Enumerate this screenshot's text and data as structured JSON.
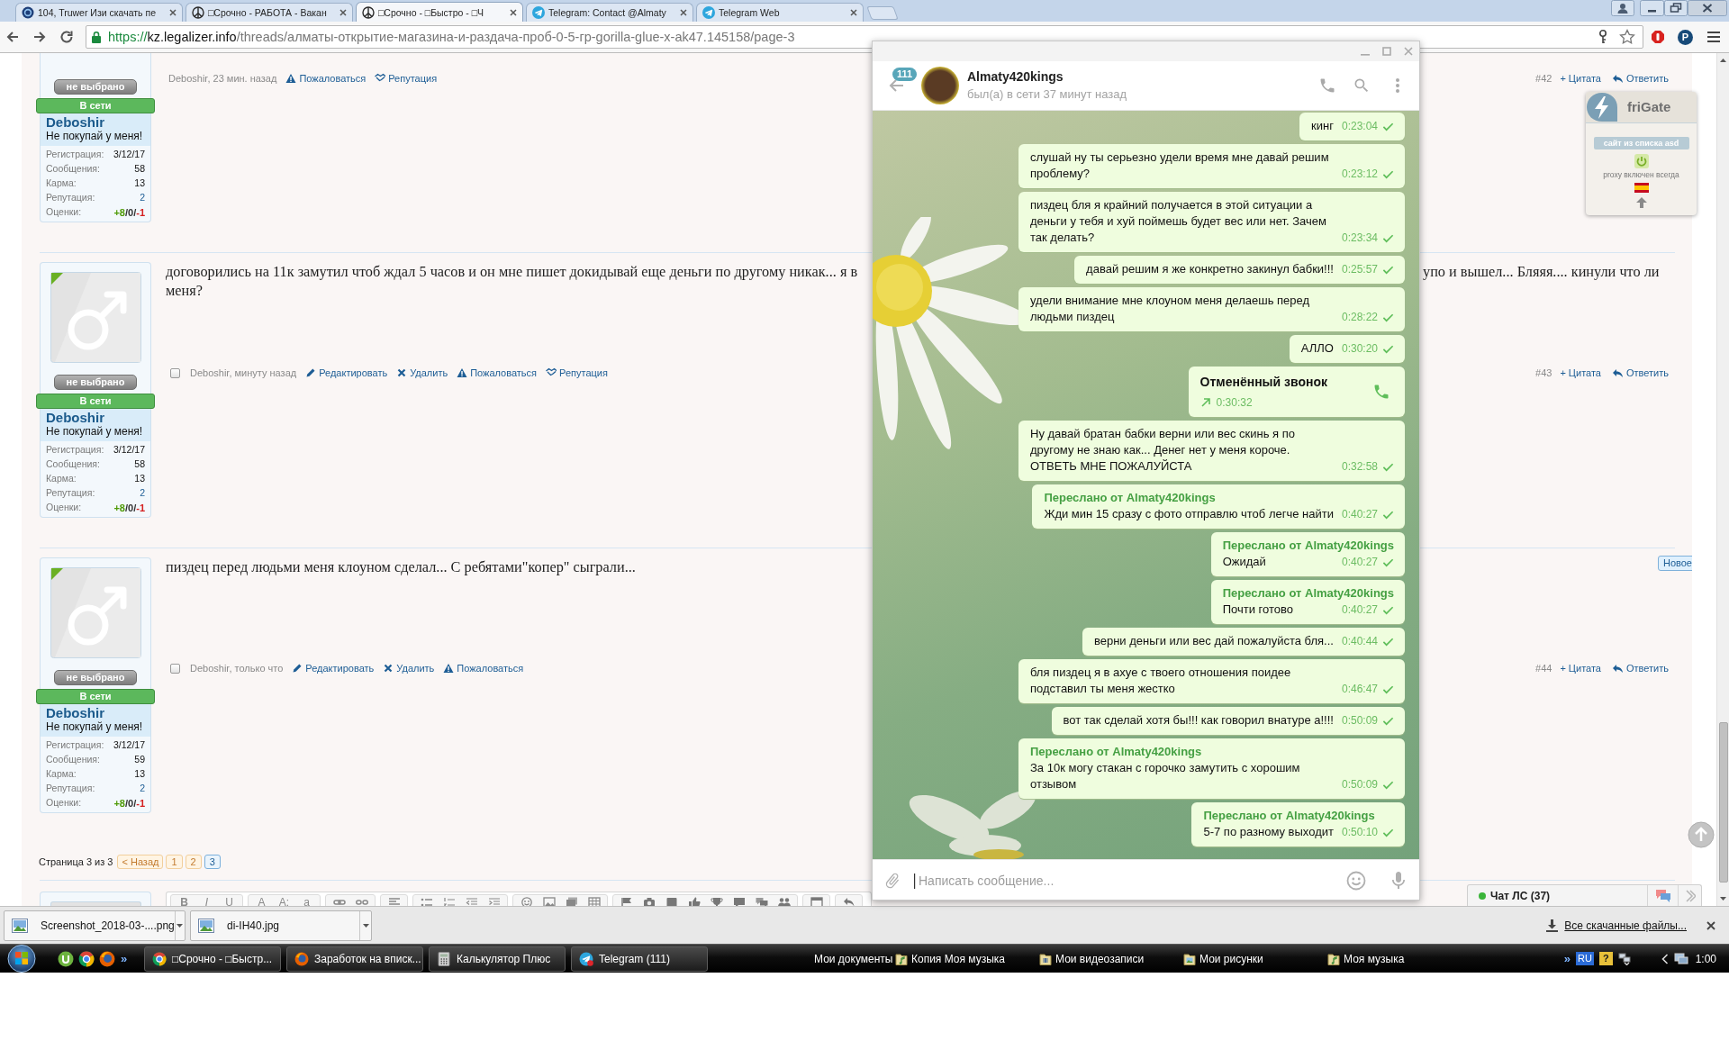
{
  "browser": {
    "tabs": [
      {
        "title": "104, Truwer Изи скачать пе",
        "kind": "site",
        "selected": false
      },
      {
        "title": "□Срочно - РАБОТА - Вакан",
        "kind": "peace",
        "selected": false
      },
      {
        "title": "□Срочно - □Быстро - □Ч",
        "kind": "peace",
        "selected": true
      },
      {
        "title": "Telegram: Contact @Almaty",
        "kind": "telegram",
        "selected": false
      },
      {
        "title": "Telegram Web",
        "kind": "telegram",
        "selected": false
      }
    ],
    "address": {
      "scheme": "https://",
      "host": "kz.legalizer.info",
      "path": "/threads/алматы-открытие-магазина-и-раздача-проб-0-5-гр-gorilla-glue-x-ak47.145158/page-3"
    },
    "extension_label": "P"
  },
  "forum": {
    "posts": [
      {
        "number": "#42",
        "avatar": false,
        "user": {
          "choice": "не выбрано",
          "status": "В сети",
          "name": "Deboshir",
          "title": "Не покупай у меня!",
          "stats": [
            {
              "label": "Регистрация:",
              "value": "3/12/17",
              "kind": "plain"
            },
            {
              "label": "Сообщения:",
              "value": "58",
              "kind": "plain"
            },
            {
              "label": "Карма:",
              "value": "13",
              "kind": "plain"
            },
            {
              "label": "Репутация:",
              "value": "2",
              "kind": "link"
            },
            {
              "label": "Оценки:",
              "kind": "ratings",
              "parts": [
                {
                  "text": "+8",
                  "color": "#4e9a06"
                },
                {
                  "text": "/0/",
                  "color": "#333333"
                },
                {
                  "text": "-1",
                  "color": "#d42020"
                }
              ]
            }
          ]
        },
        "byline": "Deboshir, 23 мин. назад",
        "actions": [
          {
            "label": "Пожаловаться",
            "kind": "report"
          },
          {
            "label": "Репутация",
            "kind": "reputation"
          }
        ],
        "quote": "+ Цитата",
        "reply": "Ответить"
      },
      {
        "number": "#43",
        "avatar": true,
        "user": {
          "choice": "не выбрано",
          "status": "В сети",
          "name": "Deboshir",
          "title": "Не покупай у меня!",
          "stats": [
            {
              "label": "Регистрация:",
              "value": "3/12/17",
              "kind": "plain"
            },
            {
              "label": "Сообщения:",
              "value": "58",
              "kind": "plain"
            },
            {
              "label": "Карма:",
              "value": "13",
              "kind": "plain"
            },
            {
              "label": "Репутация:",
              "value": "2",
              "kind": "link"
            },
            {
              "label": "Оценки:",
              "kind": "ratings",
              "parts": [
                {
                  "text": "+8",
                  "color": "#4e9a06"
                },
                {
                  "text": "/0/",
                  "color": "#333333"
                },
                {
                  "text": "-1",
                  "color": "#d42020"
                }
              ]
            }
          ]
        },
        "lines": [
          [
            "договорились на 11к замутил чтоб ждал 5 часов и он мне пишет докидывай еще деньги по другому никак... я в",
            "упо и вышел... Бляяя.... кинули что ли"
          ],
          [
            "меня?"
          ]
        ],
        "checked": false,
        "byline": "Deboshir, минуту назад",
        "actions": [
          {
            "label": "Редактировать",
            "kind": "edit"
          },
          {
            "label": "Удалить",
            "kind": "delete"
          },
          {
            "label": "Пожаловаться",
            "kind": "report"
          },
          {
            "label": "Репутация",
            "kind": "reputation"
          }
        ],
        "quote": "+ Цитата",
        "reply": "Ответить"
      },
      {
        "number": "#44",
        "avatar": true,
        "badge": "Новое",
        "user": {
          "choice": "не выбрано",
          "status": "В сети",
          "name": "Deboshir",
          "title": "Не покупай у меня!",
          "stats": [
            {
              "label": "Регистрация:",
              "value": "3/12/17",
              "kind": "plain"
            },
            {
              "label": "Сообщения:",
              "value": "59",
              "kind": "plain"
            },
            {
              "label": "Карма:",
              "value": "13",
              "kind": "plain"
            },
            {
              "label": "Репутация:",
              "value": "2",
              "kind": "link"
            },
            {
              "label": "Оценки:",
              "kind": "ratings",
              "parts": [
                {
                  "text": "+8",
                  "color": "#4e9a06"
                },
                {
                  "text": "/0/",
                  "color": "#333333"
                },
                {
                  "text": "-1",
                  "color": "#d42020"
                }
              ]
            }
          ]
        },
        "lines": [
          [
            "пиздец перед людьми меня клоуном сделал... С ребятами\"копер\" сыграли..."
          ]
        ],
        "checked": false,
        "byline": "Deboshir, только что",
        "actions": [
          {
            "label": "Редактировать",
            "kind": "edit"
          },
          {
            "label": "Удалить",
            "kind": "delete"
          },
          {
            "label": "Пожаловаться",
            "kind": "report"
          }
        ],
        "quote": "+ Цитата",
        "reply": "Ответить"
      }
    ],
    "pagination": {
      "label": "Страница 3 из 3",
      "prev": "< Назад",
      "pages": [
        {
          "label": "1",
          "selected": false
        },
        {
          "label": "2",
          "selected": false
        },
        {
          "label": "3",
          "selected": true
        }
      ]
    },
    "editor_toolbar": {
      "groups": [
        [
          {
            "kind": "bold",
            "label": "B"
          },
          {
            "kind": "italic",
            "label": "I"
          },
          {
            "kind": "underline",
            "label": "U"
          }
        ],
        [
          {
            "kind": "letter",
            "label": "A"
          },
          {
            "kind": "letter",
            "label": "A:"
          },
          {
            "kind": "letter",
            "label": "a"
          }
        ],
        [
          {
            "kind": "link"
          },
          {
            "kind": "unlink"
          }
        ],
        [
          {
            "kind": "align"
          }
        ],
        [
          {
            "kind": "list"
          },
          {
            "kind": "numbered-list"
          },
          {
            "kind": "outdent"
          },
          {
            "kind": "indent"
          }
        ],
        [
          {
            "kind": "smiley"
          },
          {
            "kind": "image"
          },
          {
            "kind": "media"
          },
          {
            "kind": "table"
          }
        ],
        [
          {
            "kind": "flag"
          },
          {
            "kind": "camera"
          },
          {
            "kind": "square"
          },
          {
            "kind": "thumb"
          },
          {
            "kind": "trophy"
          },
          {
            "kind": "comment"
          },
          {
            "kind": "comments"
          },
          {
            "kind": "users"
          }
        ],
        [
          {
            "kind": "box"
          }
        ],
        [
          {
            "kind": "undo"
          }
        ]
      ]
    },
    "frigate": {
      "title": "friGate",
      "button": "сайт из списка asd",
      "status": "proxy включен всегда"
    },
    "chat_bar": {
      "label": "Чат ЛС (37)"
    }
  },
  "telegram": {
    "chat": {
      "unread": "111",
      "name": "Almaty420kings",
      "status": "был(а) в сети 37 минут назад"
    },
    "messages": [
      {
        "kind": "text",
        "text": "кинг",
        "time": "0:23:04",
        "read": false
      },
      {
        "kind": "text",
        "text": "слушай ну ты серьезно удели время мне давай решим проблему?",
        "time": "0:23:12",
        "read": false
      },
      {
        "kind": "text",
        "text": "пиздец бля я крайний получается в этой ситуации а деньги у тебя и хуй поймешь будет вес или нет. Зачем так делать?",
        "time": "0:23:34",
        "read": false
      },
      {
        "kind": "text",
        "text": "давай решим я же конкретно закинул бабки!!!",
        "time": "0:25:57",
        "read": false
      },
      {
        "kind": "text",
        "text": "удели внимание мне клоуном меня делаешь перед людьми пиздец",
        "time": "0:28:22",
        "read": false
      },
      {
        "kind": "text",
        "text": "АЛЛО",
        "time": "0:30:20",
        "read": false
      },
      {
        "kind": "call",
        "text": "Отменённый звонок",
        "time": "0:30:32"
      },
      {
        "kind": "text",
        "text": "Ну давай братан бабки верни или вес скинь я по другому не знаю как... Денег нет у меня короче. ОТВЕТЬ МНЕ ПОЖАЛУЙСТА",
        "time": "0:32:58",
        "read": false
      },
      {
        "kind": "text",
        "forwarded_from": "Переслано от Almaty420kings",
        "text": "Жди мин 15 сразу с фото отправлю чтоб легче найти",
        "time": "0:40:27",
        "read": false
      },
      {
        "kind": "text",
        "forwarded_from": "Переслано от Almaty420kings",
        "text": "Ожидай",
        "time": "0:40:27",
        "read": false
      },
      {
        "kind": "text",
        "forwarded_from": "Переслано от Almaty420kings",
        "text": "Почти готово",
        "time": "0:40:27",
        "read": false
      },
      {
        "kind": "text",
        "text": "верни деньги или вес дай пожалуйста бля...",
        "time": "0:40:44",
        "read": false
      },
      {
        "kind": "text",
        "text": "бля пиздец я в ахуе с твоего отношения поидее подставил ты меня жестко",
        "time": "0:46:47",
        "read": false
      },
      {
        "kind": "text",
        "text": "вот так сделай хотя бы!!! как говорил внатуре а!!!!",
        "time": "0:50:09",
        "read": false
      },
      {
        "kind": "text",
        "forwarded_from": "Переслано от Almaty420kings",
        "text": "За 10к могу стакан с горочко замутить с хорошим отзывом",
        "time": "0:50:09",
        "read": false
      },
      {
        "kind": "text",
        "forwarded_from": "Переслано от Almaty420kings",
        "text": "5-7 по разному выходит",
        "time": "0:50:10",
        "read": false
      }
    ],
    "input": {
      "placeholder": "Написать сообщение..."
    }
  },
  "downloads": {
    "files": [
      "Screenshot_2018-03-....png",
      "di-IH40.jpg"
    ],
    "show_all": "Все скачанные файлы..."
  },
  "taskbar": {
    "quick_launch_more": "»",
    "tasks": [
      {
        "title": "□Срочно - □Быстр...",
        "kind": "chrome"
      },
      {
        "title": "Заработок на вписк...",
        "kind": "firefox"
      },
      {
        "title": "Калькулятор Плюс",
        "kind": "calculator"
      },
      {
        "title": "Telegram (111)",
        "kind": "telegram"
      }
    ],
    "folders": [
      {
        "label": "Мои документы",
        "kind": "plain"
      },
      {
        "label": "Копия Моя музыка",
        "kind": "music"
      },
      {
        "label": "Мои видеозаписи",
        "kind": "video"
      },
      {
        "label": "Мои рисунки",
        "kind": "pictures"
      },
      {
        "label": "Моя музыка",
        "kind": "music"
      }
    ],
    "tray": {
      "more": "»",
      "language": "RU",
      "help": "?",
      "time": "1:00"
    }
  }
}
